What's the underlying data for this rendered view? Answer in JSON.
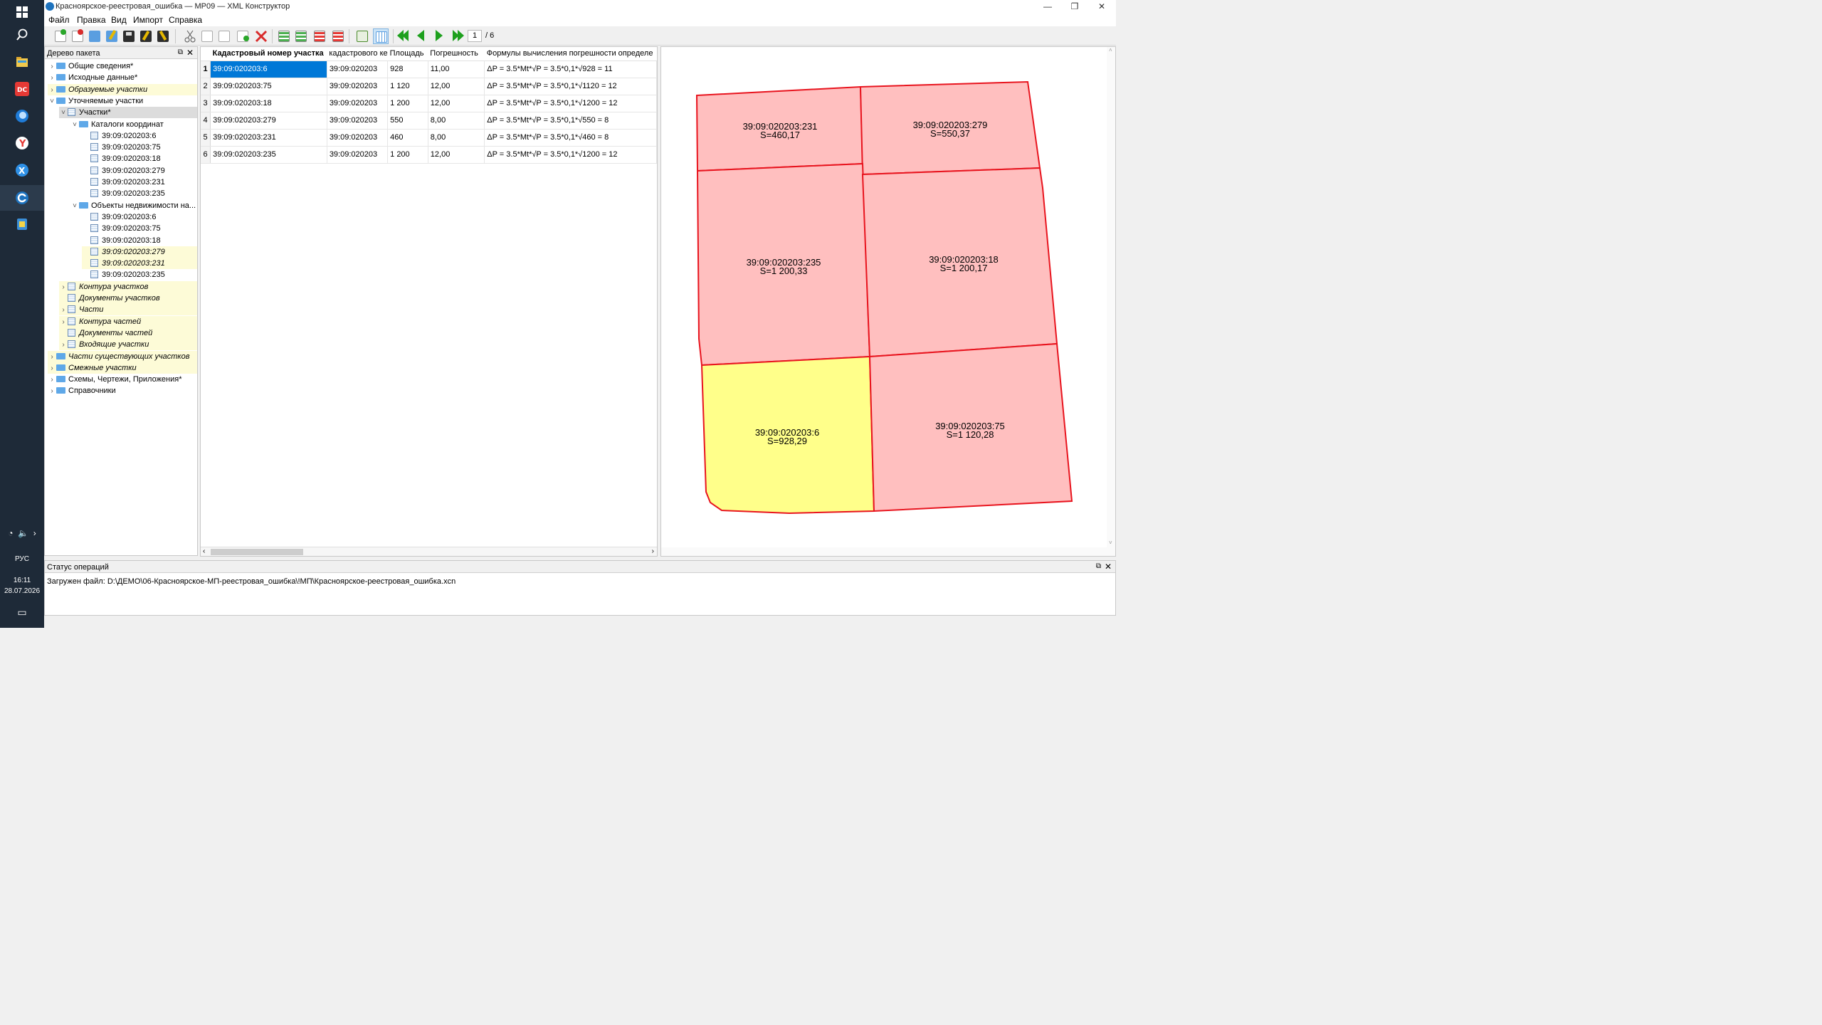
{
  "taskbar": {
    "icons": [
      "windows-start-icon",
      "search-icon",
      "file-explorer-icon",
      "pdf-app-icon",
      "thunderbird-icon",
      "yandex-browser-icon",
      "xmind-icon",
      "xml-constructor-icon",
      "notes-app-icon"
    ],
    "tray": {
      "language": "РУС",
      "time": "16:11",
      "date": "28.07.2026"
    }
  },
  "window": {
    "title": "Красноярское-реестровая_ошибка — МР09 — XML Конструктор"
  },
  "menu": [
    "Файл",
    "Правка",
    "Вид",
    "Импорт",
    "Справка"
  ],
  "toolbar": {
    "page_current": "1",
    "page_total": "/ 6"
  },
  "tree": {
    "header": "Дерево пакета",
    "nodes": [
      {
        "label": "Общие сведения*"
      },
      {
        "label": "Исходные данные*"
      },
      {
        "label": "Образуемые участки"
      },
      {
        "label": "Уточняемые участки"
      },
      {
        "label": "Участки*"
      },
      {
        "label": "Каталоги координат"
      },
      {
        "label": "39:09:020203:6"
      },
      {
        "label": "39:09:020203:75"
      },
      {
        "label": "39:09:020203:18"
      },
      {
        "label": "39:09:020203:279"
      },
      {
        "label": "39:09:020203:231"
      },
      {
        "label": "39:09:020203:235"
      },
      {
        "label": "Объекты недвижимости на..."
      },
      {
        "label": "39:09:020203:6"
      },
      {
        "label": "39:09:020203:75"
      },
      {
        "label": "39:09:020203:18"
      },
      {
        "label": "39:09:020203:279"
      },
      {
        "label": "39:09:020203:231"
      },
      {
        "label": "39:09:020203:235"
      },
      {
        "label": "Контура участков"
      },
      {
        "label": "Документы участков"
      },
      {
        "label": "Части"
      },
      {
        "label": "Контура частей"
      },
      {
        "label": "Документы частей"
      },
      {
        "label": "Входящие участки"
      },
      {
        "label": "Части существующих участков"
      },
      {
        "label": "Смежные участки"
      },
      {
        "label": "Схемы, Чертежи, Приложения*"
      },
      {
        "label": "Справочники"
      }
    ]
  },
  "table": {
    "columns": [
      "Кадастровый номер участка",
      "кадастрового ке",
      "Площадь",
      "Погрешность",
      "Формулы вычисления погрешности определе"
    ],
    "rows": [
      {
        "n": "1",
        "cad": "39:09:020203:6",
        "block": "39:09:020203",
        "area": "928",
        "err": "11,00",
        "formula": "ΔP = 3.5*Mt*√P = 3.5*0,1*√928 = 11"
      },
      {
        "n": "2",
        "cad": "39:09:020203:75",
        "block": "39:09:020203",
        "area": "1 120",
        "err": "12,00",
        "formula": "ΔP = 3.5*Mt*√P = 3.5*0,1*√1120 = 12"
      },
      {
        "n": "3",
        "cad": "39:09:020203:18",
        "block": "39:09:020203",
        "area": "1 200",
        "err": "12,00",
        "formula": "ΔP = 3.5*Mt*√P = 3.5*0,1*√1200 = 12"
      },
      {
        "n": "4",
        "cad": "39:09:020203:279",
        "block": "39:09:020203",
        "area": "550",
        "err": "8,00",
        "formula": "ΔP = 3.5*Mt*√P = 3.5*0,1*√550 = 8"
      },
      {
        "n": "5",
        "cad": "39:09:020203:231",
        "block": "39:09:020203",
        "area": "460",
        "err": "8,00",
        "formula": "ΔP = 3.5*Mt*√P = 3.5*0,1*√460 = 8"
      },
      {
        "n": "6",
        "cad": "39:09:020203:235",
        "block": "39:09:020203",
        "area": "1 200",
        "err": "12,00",
        "formula": "ΔP = 3.5*Mt*√P = 3.5*0,1*√1200 = 12"
      }
    ]
  },
  "map": {
    "parcels": [
      {
        "id": "39:09:020203:231",
        "area": "S=460,17",
        "selected": false
      },
      {
        "id": "39:09:020203:279",
        "area": "S=550,37",
        "selected": false
      },
      {
        "id": "39:09:020203:235",
        "area": "S=1 200,33",
        "selected": false
      },
      {
        "id": "39:09:020203:18",
        "area": "S=1 200,17",
        "selected": false
      },
      {
        "id": "39:09:020203:6",
        "area": "S=928,29",
        "selected": true
      },
      {
        "id": "39:09:020203:75",
        "area": "S=1 120,28",
        "selected": false
      }
    ],
    "colors": {
      "fill": "#ffbfbf",
      "selected_fill": "#ffff8a",
      "stroke": "#e8141e"
    }
  },
  "status": {
    "header": "Статус операций",
    "message": "Загружен файл: D:\\ДЕМО\\06-Красноярское-МП-реестровая_ошибка\\!МП\\Красноярское-реестровая_ошибка.xcn"
  }
}
